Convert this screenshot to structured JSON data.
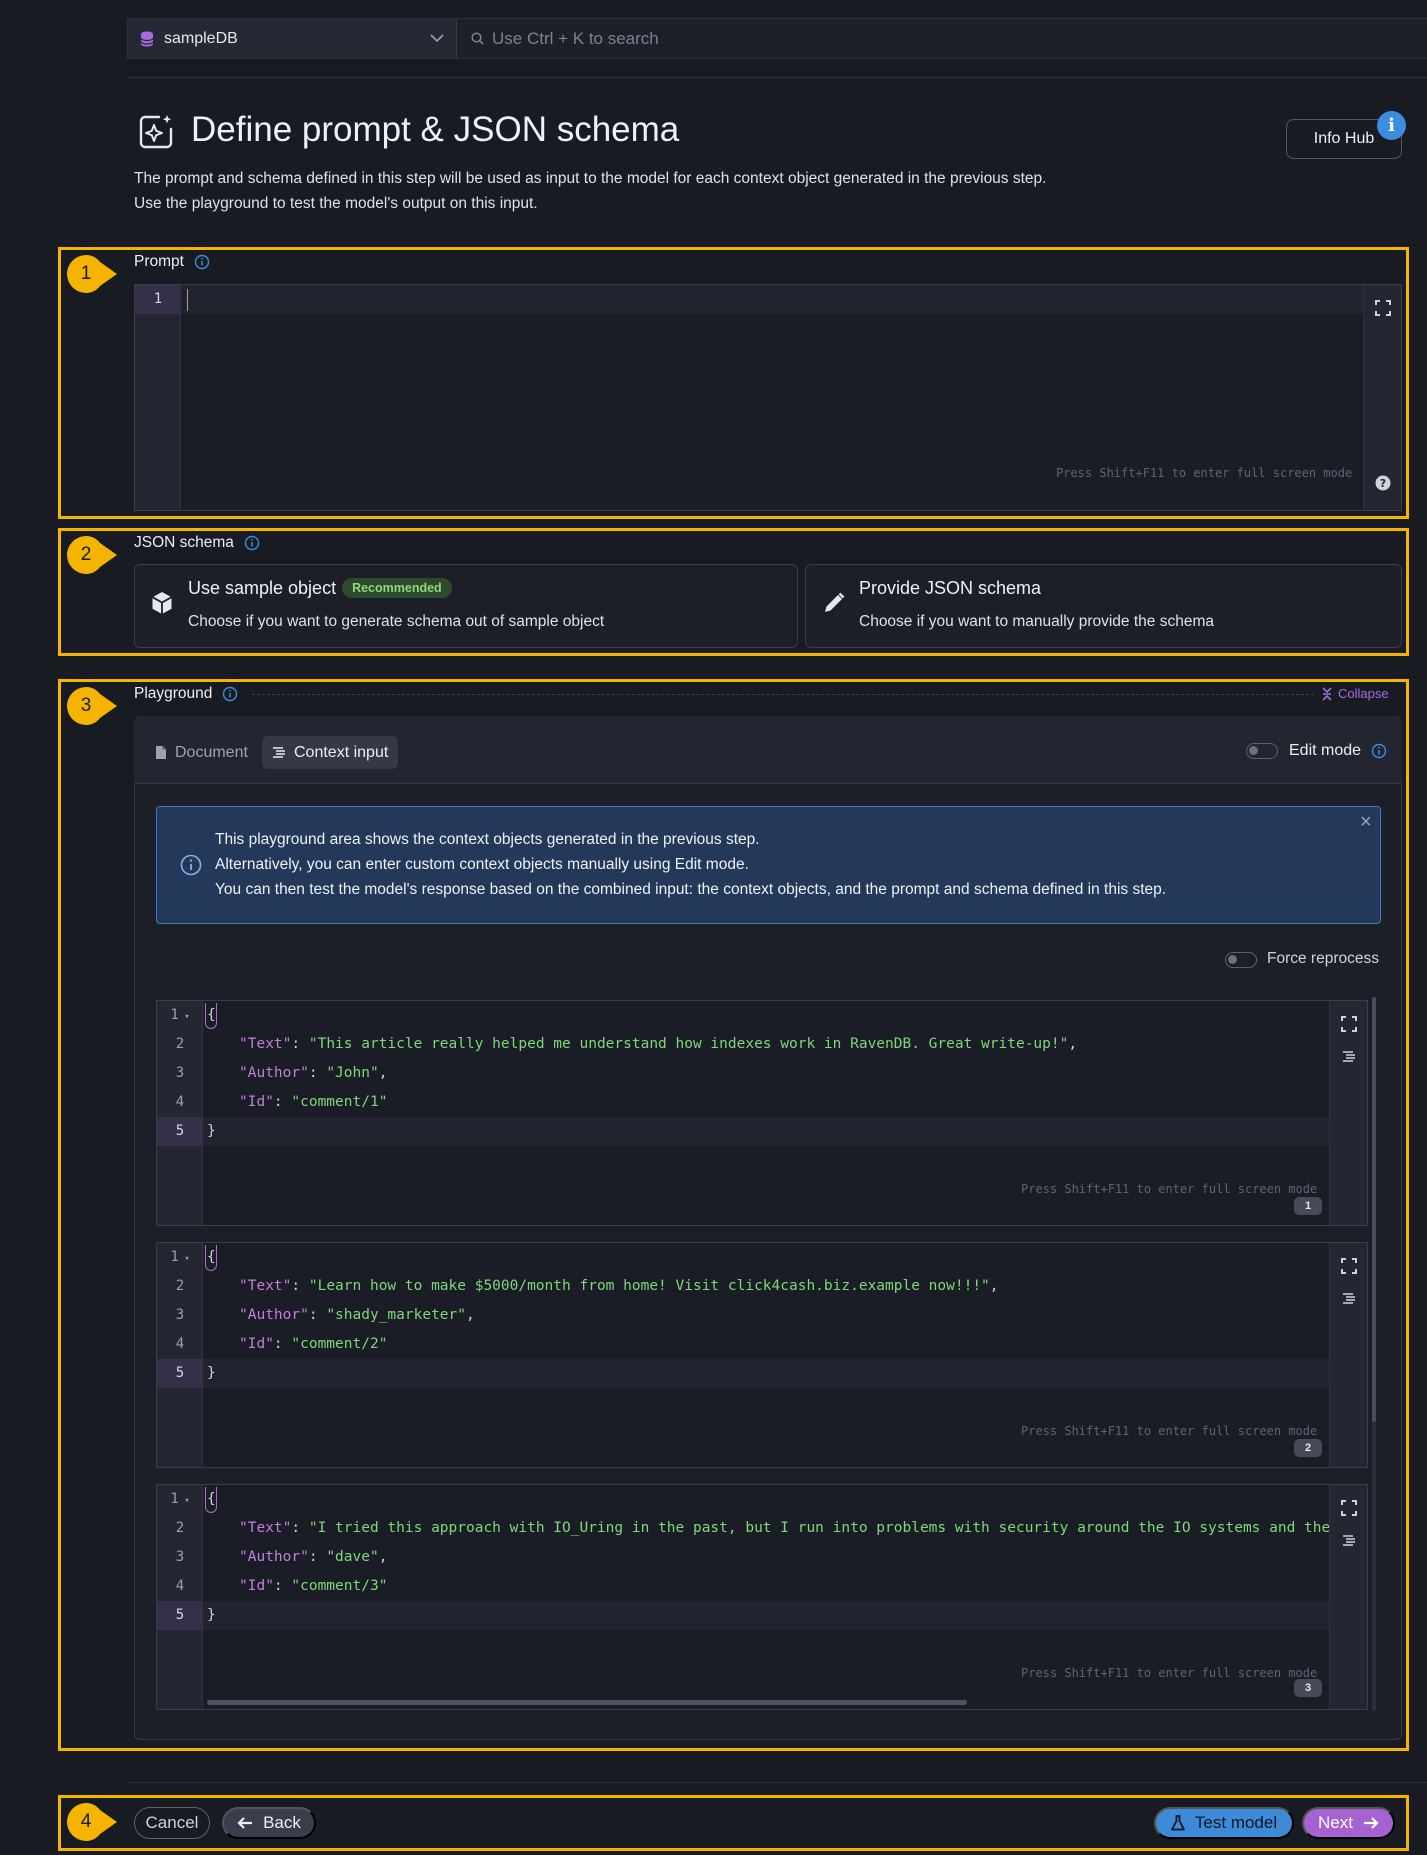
{
  "topbar": {
    "database": "sampleDB",
    "search_placeholder": "Use Ctrl + K to search"
  },
  "header": {
    "title": "Define prompt & JSON schema",
    "description_line1": "The prompt and schema defined in this step will be used as input to the model for each context object generated in the previous step.",
    "description_line2": "Use the playground to test the model's output on this input.",
    "info_hub": "Info Hub",
    "info_badge": "i"
  },
  "steps": [
    "1",
    "2",
    "3",
    "4"
  ],
  "prompt": {
    "label": "Prompt",
    "line_number": "1",
    "hint": "Press Shift+F11 to enter full screen mode"
  },
  "schema": {
    "label": "JSON schema",
    "sample_title": "Use sample object",
    "sample_badge": "Recommended",
    "sample_sub": "Choose if you want to generate schema out of sample object",
    "provide_title": "Provide JSON schema",
    "provide_sub": "Choose if you want to manually provide the schema"
  },
  "playground": {
    "label": "Playground",
    "collapse": "Collapse",
    "tab_document": "Document",
    "tab_context": "Context input",
    "edit_mode": "Edit mode",
    "alert_line1": "This playground area shows the context objects generated in the previous step.",
    "alert_line2": "Alternatively, you can enter custom context objects manually using Edit mode.",
    "alert_line3": "You can then test the model's response based on the combined input: the context objects, and the prompt and schema defined in this step.",
    "alert_close": "×",
    "force_reprocess": "Force reprocess",
    "hint": "Press Shift+F11 to enter full screen mode",
    "docs": [
      {
        "number": "1",
        "text_key": "\"Text\"",
        "text_val": "\"This article really helped me understand how indexes work in RavenDB. Great write-up!\"",
        "author_key": "\"Author\"",
        "author_val": "\"John\"",
        "id_key": "\"Id\"",
        "id_val": "\"comment/1\""
      },
      {
        "number": "2",
        "text_key": "\"Text\"",
        "text_val": "\"Learn how to make $5000/month from home! Visit click4cash.biz.example now!!!\"",
        "author_key": "\"Author\"",
        "author_val": "\"shady_marketer\"",
        "id_key": "\"Id\"",
        "id_val": "\"comment/2\""
      },
      {
        "number": "3",
        "text_key": "\"Text\"",
        "text_val": "\"I tried this approach with IO_Uring in the past, but I run into problems with security around the IO systems and the CISO didn't l",
        "author_key": "\"Author\"",
        "author_val": "\"dave\"",
        "id_key": "\"Id\"",
        "id_val": "\"comment/3\""
      }
    ]
  },
  "footer": {
    "cancel": "Cancel",
    "back": "Back",
    "test_model": "Test model",
    "next": "Next"
  },
  "colors": {
    "frame": "#f5b400",
    "accent_purple": "#a562d0",
    "accent_blue": "#3d8bd8",
    "string_green": "#7ed87a",
    "key_purple": "#c57ddd"
  }
}
